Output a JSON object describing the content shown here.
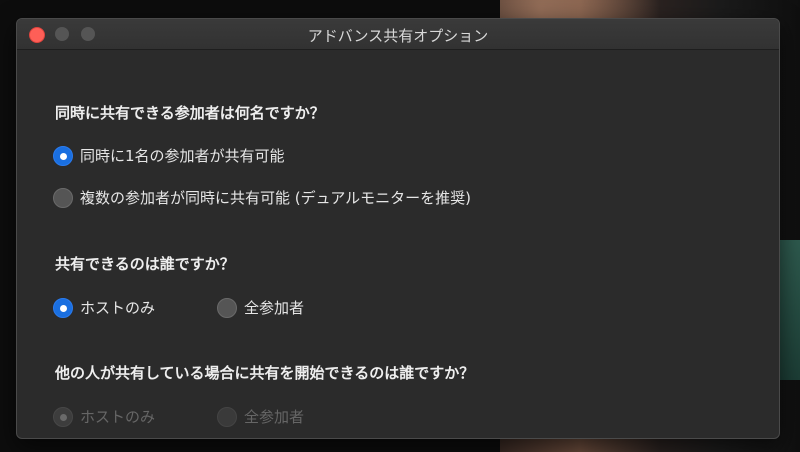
{
  "window": {
    "title": "アドバンス共有オプション"
  },
  "sections": [
    {
      "question": "同時に共有できる参加者は何名ですか？",
      "options": [
        {
          "label": "同時に1名の参加者が共有可能",
          "selected": true,
          "enabled": true
        },
        {
          "label": "複数の参加者が同時に共有可能 (デュアルモニターを推奨)",
          "selected": false,
          "enabled": true
        }
      ]
    },
    {
      "question": "共有できるのは誰ですか？",
      "options": [
        {
          "label": "ホストのみ",
          "selected": true,
          "enabled": true
        },
        {
          "label": "全参加者",
          "selected": false,
          "enabled": true
        }
      ]
    },
    {
      "question": "他の人が共有している場合に共有を開始できるのは誰ですか？",
      "options": [
        {
          "label": "ホストのみ",
          "selected": true,
          "enabled": false
        },
        {
          "label": "全参加者",
          "selected": false,
          "enabled": false
        }
      ]
    }
  ],
  "colors": {
    "accent": "#1a6fe0",
    "close_button": "#fe5f57",
    "window_bg": "#2b2b2b"
  }
}
